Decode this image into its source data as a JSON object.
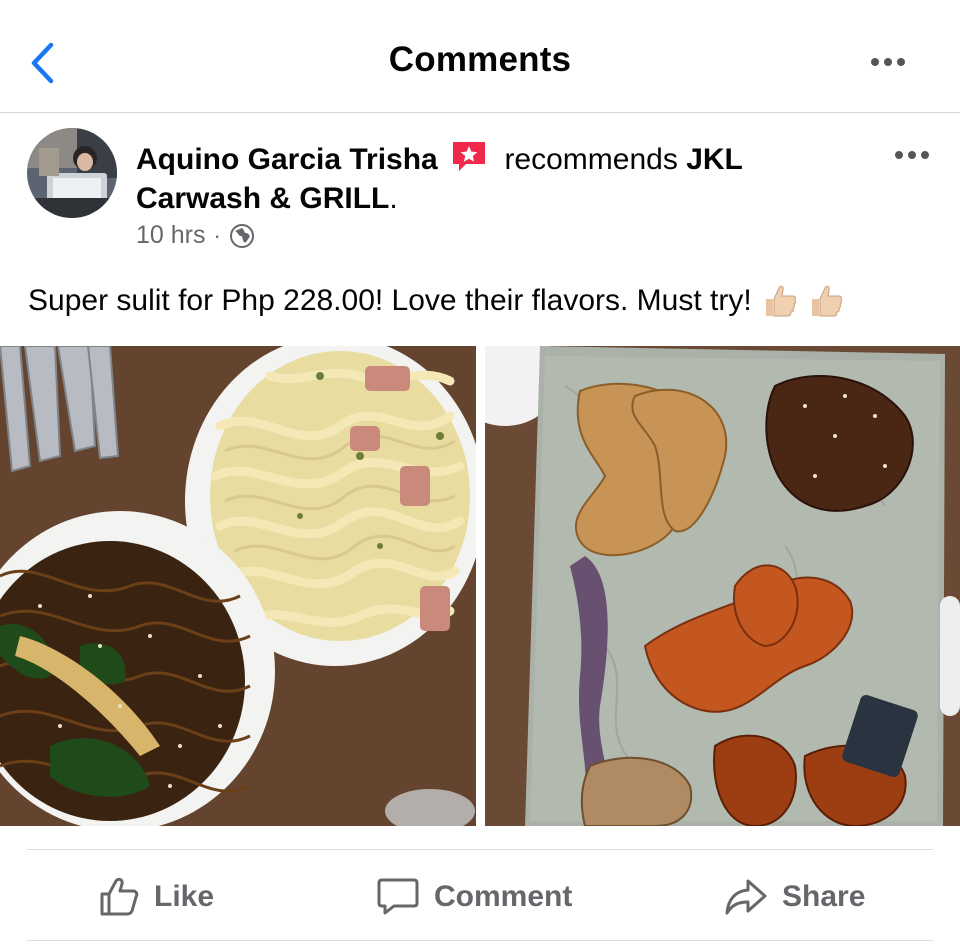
{
  "header": {
    "title": "Comments",
    "back_icon": "chevron-left-icon",
    "more_icon": "more-horizontal-icon",
    "accent": "#1877f2"
  },
  "post": {
    "author": "Aquino Garcia Trisha",
    "recommend_icon": "recommend-star-icon",
    "recommend_text": "recommends",
    "page_name_line1": "JKL",
    "page_name_line2": "Carwash & GRILL",
    "period": ".",
    "time": "10 hrs",
    "separator": "·",
    "privacy_icon": "globe-icon",
    "text": "Super sulit for Php 228.00! Love their flavors. Must try!",
    "emojis": [
      "thumbs-up-icon",
      "thumbs-up-icon"
    ],
    "photos": [
      "food-photo-pasta-noodles",
      "food-photo-chicken-wings"
    ]
  },
  "actions": {
    "like": "Like",
    "comment": "Comment",
    "share": "Share"
  }
}
